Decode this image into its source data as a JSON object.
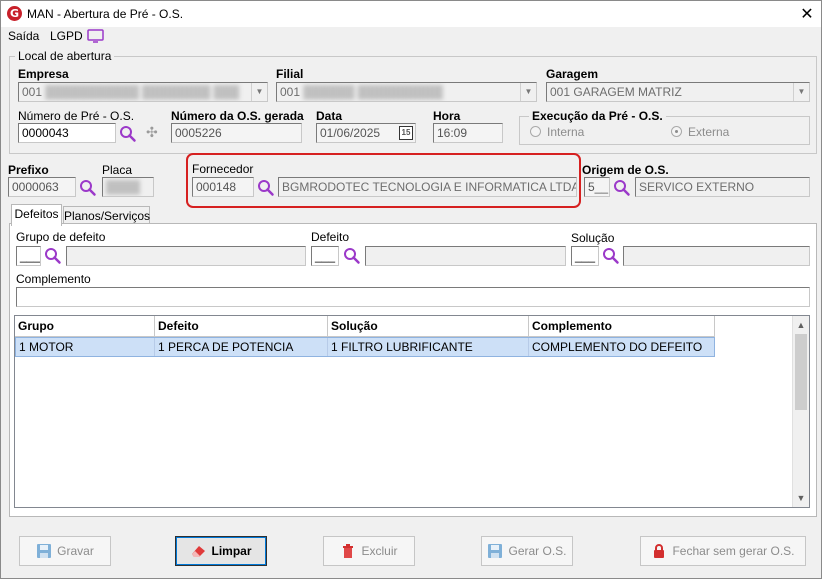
{
  "window": {
    "title": "MAN - Abertura de Pré - O.S.",
    "logo_letter": "G",
    "close_glyph": "✕"
  },
  "menu": {
    "saida": "Saída",
    "lgpd": "LGPD"
  },
  "local": {
    "legend": "Local de abertura",
    "empresa_label": "Empresa",
    "empresa_value": "001",
    "empresa_blurred": "███████████ ████████ ███",
    "filial_label": "Filial",
    "filial_value": "001",
    "filial_blurred": "██████ ██████████",
    "garagem_label": "Garagem",
    "garagem_value": "001 GARAGEM MATRIZ",
    "num_pre_label": "Número de Pré - O.S.",
    "num_pre_value": "0000043",
    "num_os_label": "Número da O.S. gerada",
    "num_os_value": "0005226",
    "data_label": "Data",
    "data_value": "01/06/2025",
    "data_btn": "15",
    "hora_label": "Hora",
    "hora_value": "16:09",
    "execucao_legend": "Execução da Pré - O.S.",
    "interna_label": "Interna",
    "externa_label": "Externa"
  },
  "vehicle": {
    "prefixo_label": "Prefixo",
    "prefixo_value": "0000063",
    "placa_label": "Placa",
    "placa_blurred": "████",
    "fornecedor_label": "Fornecedor",
    "fornecedor_code": "000148",
    "fornecedor_name": "BGMRODOTEC TECNOLOGIA E INFORMATICA LTDA",
    "origem_label": "Origem de O.S.",
    "origem_code": "5__",
    "origem_name": "SERVICO EXTERNO"
  },
  "tabs": [
    {
      "label": "Defeitos",
      "active": true
    },
    {
      "label": "Planos/Serviços",
      "active": false
    }
  ],
  "defeitos": {
    "grupo_label": "Grupo de defeito",
    "grupo_code": "___",
    "defeito_label": "Defeito",
    "defeito_code": "___",
    "solucao_label": "Solução",
    "solucao_code": "___",
    "complemento_label": "Complemento",
    "complemento_value": ""
  },
  "grid": {
    "columns": [
      "Grupo",
      "Defeito",
      "Solução",
      "Complemento"
    ],
    "rows": [
      [
        "1 MOTOR",
        "1 PERCA DE POTENCIA",
        "1 FILTRO LUBRIFICANTE",
        "COMPLEMENTO DO DEFEITO"
      ]
    ]
  },
  "buttons": {
    "gravar": "Gravar",
    "limpar": "Limpar",
    "excluir": "Excluir",
    "gerar": "Gerar O.S.",
    "fechar": "Fechar sem gerar O.S."
  },
  "colors": {
    "accent": "#0078d7",
    "highlight": "#d62020",
    "magnifier": "#9b39c9",
    "row_selected": "#cde0f7"
  }
}
